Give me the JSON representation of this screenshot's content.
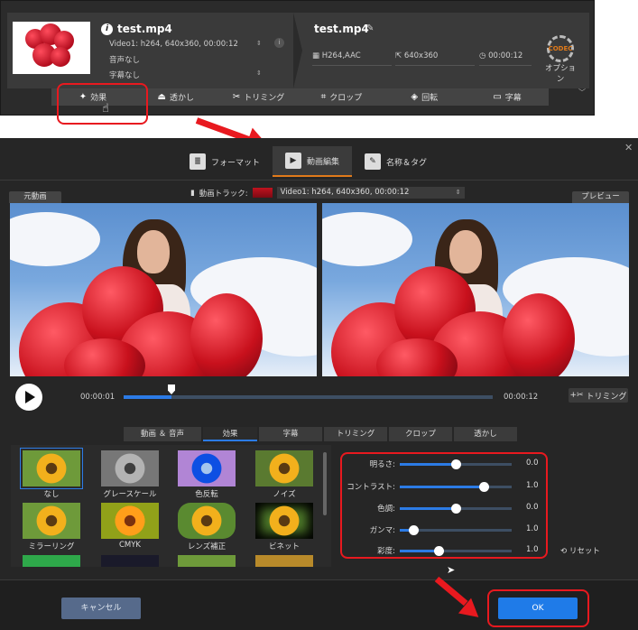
{
  "top": {
    "file_name": "test.mp4",
    "video_info": "Video1: h264, 640x360, 00:00:12",
    "audio": "音声なし",
    "subtitle": "字幕なし",
    "output_name": "test.mp4",
    "output_format": "H264,AAC",
    "output_resolution": "640x360",
    "output_duration": "00:00:12",
    "option_label": "オプション",
    "option_gear_text": "CODEC",
    "tools": [
      {
        "icon": "effect-icon",
        "label": "効果"
      },
      {
        "icon": "watermark-icon",
        "label": "透かし"
      },
      {
        "icon": "scissors-icon",
        "label": "トリミング"
      },
      {
        "icon": "crop-icon",
        "label": "クロップ"
      },
      {
        "icon": "rotate-icon",
        "label": "回転"
      },
      {
        "icon": "subtitle-icon",
        "label": "字幕"
      }
    ]
  },
  "dialog": {
    "tabs": [
      {
        "icon": "format-icon",
        "label": "フォーマット"
      },
      {
        "icon": "video-edit-icon",
        "label": "動画編集"
      },
      {
        "icon": "name-tag-icon",
        "label": "名称＆タグ"
      }
    ],
    "original_label": "元動画",
    "preview_label": "プレビュー",
    "track_label": "動画トラック:",
    "track_value": "Video1: h264, 640x360, 00:00:12",
    "time_start": "00:00:01",
    "time_end": "00:00:12",
    "progress": 0.13,
    "trim_button": "トリミング",
    "sub_tabs": [
      "動画 ＆ 音声",
      "効果",
      "字幕",
      "トリミング",
      "クロップ",
      "透かし"
    ],
    "effects": [
      "なし",
      "グレースケール",
      "色反転",
      "ノイズ",
      "ミラーリング",
      "CMYK",
      "レンズ補正",
      "ビネット"
    ],
    "adjustments": [
      {
        "label": "明るさ:",
        "value": "0.0",
        "level": 0.5
      },
      {
        "label": "コントラスト:",
        "value": "1.0",
        "level": 0.75
      },
      {
        "label": "色調:",
        "value": "0.0",
        "level": 0.5
      },
      {
        "label": "ガンマ:",
        "value": "1.0",
        "level": 0.12
      },
      {
        "label": "彩度:",
        "value": "1.0",
        "level": 0.35
      }
    ],
    "reset_label": "リセット",
    "cancel_label": "キャンセル",
    "ok_label": "OK"
  },
  "colors": {
    "accent": "#2c7be5",
    "highlight": "#e8191f",
    "tab_underline": "#e07a1a",
    "ok_button": "#1f7be8",
    "cancel_button": "#566a8b"
  }
}
